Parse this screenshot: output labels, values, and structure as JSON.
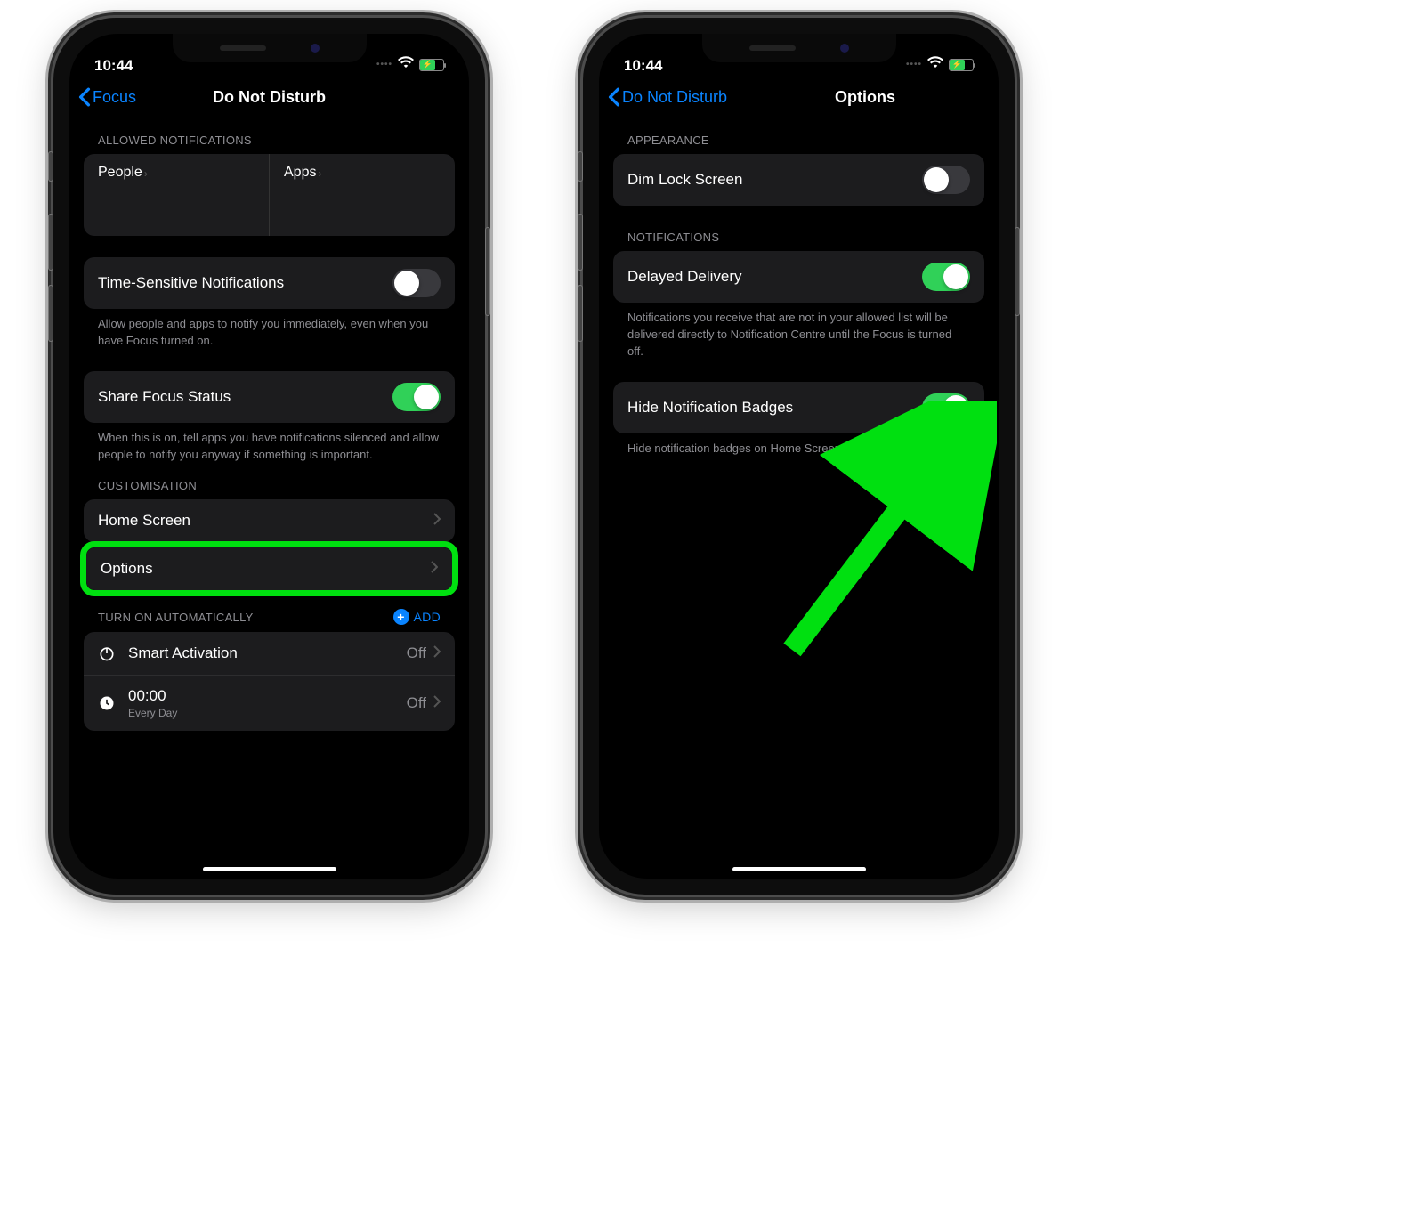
{
  "status": {
    "time": "10:44"
  },
  "left": {
    "back": "Focus",
    "title": "Do Not Disturb",
    "sec_allowed": "ALLOWED NOTIFICATIONS",
    "people": "People",
    "apps": "Apps",
    "tsn": "Time-Sensitive Notifications",
    "tsn_foot": "Allow people and apps to notify you immediately, even when you have Focus turned on.",
    "share": "Share Focus Status",
    "share_foot": "When this is on, tell apps you have notifications silenced and allow people to notify you anyway if something is important.",
    "sec_custom": "CUSTOMISATION",
    "home": "Home Screen",
    "options": "Options",
    "sec_auto": "TURN ON AUTOMATICALLY",
    "add": "ADD",
    "smart": "Smart Activation",
    "smart_val": "Off",
    "sched_time": "00:00",
    "sched_sub": "Every Day",
    "sched_val": "Off"
  },
  "right": {
    "back": "Do Not Disturb",
    "title": "Options",
    "sec_appear": "APPEARANCE",
    "dim": "Dim Lock Screen",
    "sec_notif": "NOTIFICATIONS",
    "delayed": "Delayed Delivery",
    "delayed_foot": "Notifications you receive that are not in your allowed list will be delivered directly to Notification Centre until the Focus is turned off.",
    "hide": "Hide Notification Badges",
    "hide_foot": "Hide notification badges on Home Screen apps"
  }
}
